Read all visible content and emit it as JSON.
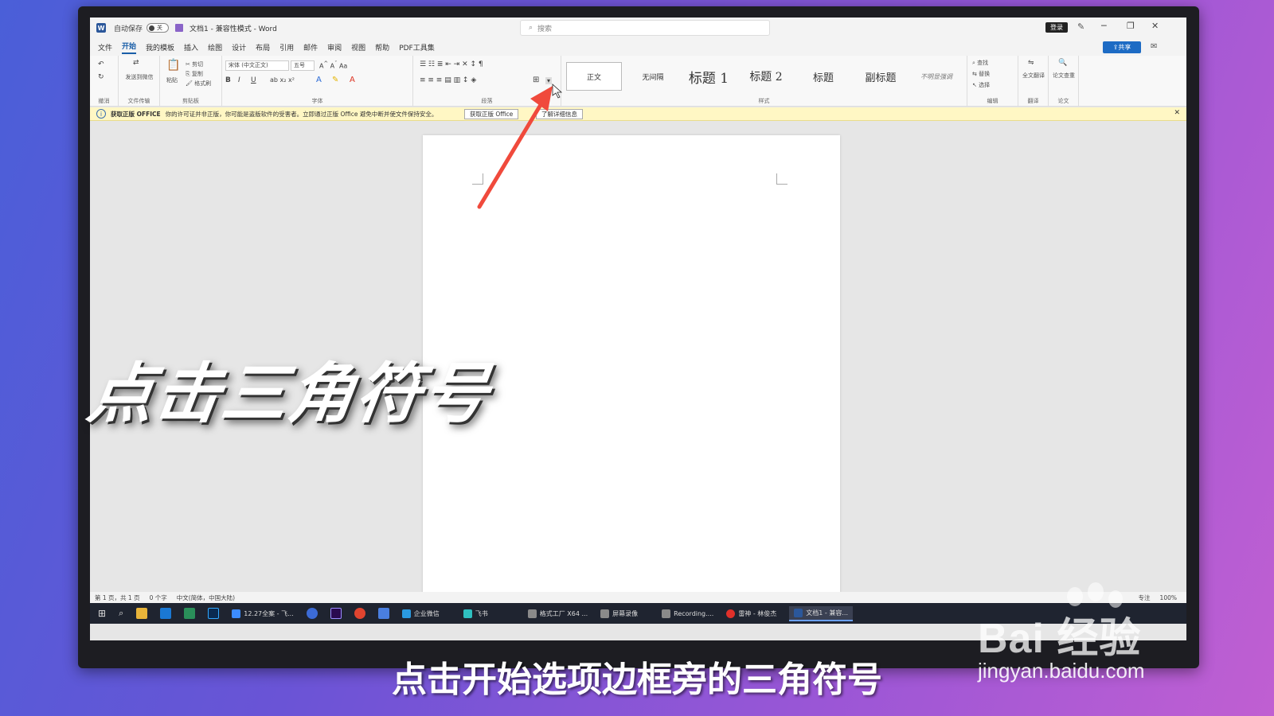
{
  "window": {
    "autosave_label": "自动保存",
    "autosave_state": "关",
    "doc_title": "文档1 - 兼容性模式 - Word",
    "search_placeholder": "搜索",
    "login_label": "登录",
    "share_label": "共享"
  },
  "menu": {
    "items": [
      "文件",
      "开始",
      "我的模板",
      "插入",
      "绘图",
      "设计",
      "布局",
      "引用",
      "邮件",
      "审阅",
      "视图",
      "帮助",
      "PDF工具集"
    ],
    "active": "开始"
  },
  "ribbon": {
    "groups": [
      "撤消",
      "文件传输",
      "剪贴板",
      "字体",
      "段落",
      "样式",
      "编辑",
      "翻译",
      "论文"
    ],
    "send_label": "发送到微信",
    "paste_label": "粘贴",
    "cut_label": "剪切",
    "copy_label": "复制",
    "format_painter_label": "格式刷",
    "font_name": "宋体 (中文正文)",
    "font_size": "五号",
    "styles": [
      "正文",
      "无间隔",
      "标题 1",
      "标题 2",
      "标题",
      "副标题",
      "不明显强调"
    ],
    "find_label": "查找",
    "replace_label": "替换",
    "select_label": "选择",
    "translate_label": "全文翻译",
    "paper_label": "论文查重"
  },
  "infobar": {
    "title": "获取正版 OFFICE",
    "message": "你的许可证并非正版，你可能是盗版软件的受害者。立即通过正版 Office 避免中断并使文件保持安全。",
    "button_get": "获取正版 Office",
    "button_more": "了解详细信息"
  },
  "statusbar": {
    "page": "第 1 页，共 1 页",
    "words": "0 个字",
    "language": "中文(简体，中国大陆)",
    "focus": "专注",
    "zoom": "100%"
  },
  "taskbar": {
    "apps": [
      "12.27全案 - 飞...",
      "企业微信",
      "飞书",
      "格式工厂 X64 ...",
      "屏幕录像",
      "Recording....",
      "雷神 - 林俊杰",
      "文档1 - 兼容..."
    ]
  },
  "overlay": {
    "caption_big": "点击三角符号",
    "subtitle": "点击开始选项边框旁的三角符号",
    "watermark": "Bai 经验",
    "watermark_url": "jingyan.baidu.com"
  },
  "colors": {
    "accent": "#1d6bc4",
    "arrow": "#f04a3c",
    "infobar": "#fff7c4"
  }
}
